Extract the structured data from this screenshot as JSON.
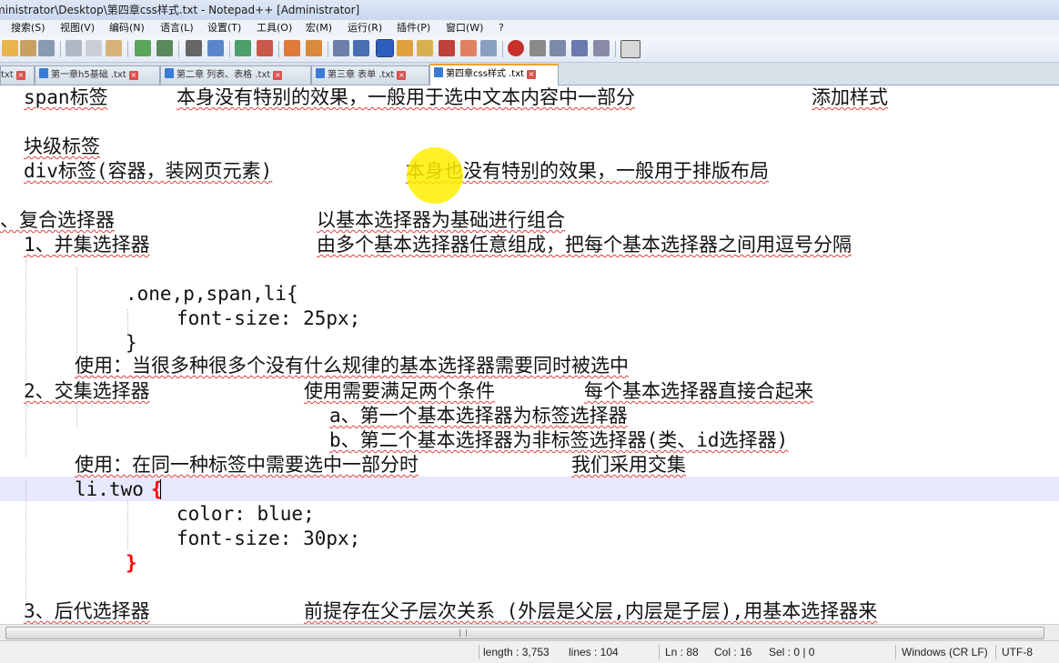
{
  "window": {
    "title": "ministrator\\Desktop\\第四章css样式.txt - Notepad++ [Administrator]"
  },
  "menu": [
    "搜索(S)",
    "视图(V)",
    "编码(N)",
    "语言(L)",
    "设置(T)",
    "工具(O)",
    "宏(M)",
    "运行(R)",
    "插件(P)",
    "窗口(W)",
    "?"
  ],
  "tabs": [
    {
      "label": "txt",
      "active": false
    },
    {
      "label": "第一章h5基础 .txt",
      "active": false
    },
    {
      "label": "第二章 列表、表格 .txt",
      "active": false
    },
    {
      "label": "第三章 表单 .txt",
      "active": false
    },
    {
      "label": "第四章css样式 .txt",
      "active": true
    }
  ],
  "editor": {
    "lines": [
      {
        "a": "span标签",
        "b": "本身没有特别的效果，一般用于选中文本内容中一部分",
        "c": "添加样式"
      },
      {
        "a": "块级标签"
      },
      {
        "a": "div标签(容器，装网页元素)",
        "b": "本身也没有特别的效果，一般用于排版布局"
      },
      {
        "a": "、复合选择器",
        "b": "以基本选择器为基础进行组合"
      },
      {
        "a": "1、并集选择器",
        "b": "由多个基本选择器任意组成，把每个基本选择器之间用逗号分隔"
      },
      {
        "a": ".one,p,span,li{"
      },
      {
        "a": "font-size: 25px;"
      },
      {
        "a": "}"
      },
      {
        "a": "使用：当很多种很多个没有什么规律的基本选择器需要同时被选中"
      },
      {
        "a": "2、交集选择器",
        "b": "使用需要满足两个条件",
        "c": "每个基本选择器直接合起来"
      },
      {
        "a": "a、第一个基本选择器为标签选择器"
      },
      {
        "a": "b、第二个基本选择器为非标签选择器(类、id选择器)"
      },
      {
        "a": "使用：在同一种标签中需要选中一部分时",
        "b": "我们采用交集"
      },
      {
        "a": "li.two",
        "brace": "{"
      },
      {
        "a": "color: blue;"
      },
      {
        "a": "font-size: 30px;"
      },
      {
        "brace": "}"
      },
      {
        "a": "3、后代选择器",
        "b": "前提存在父子层次关系 (外层是父层,内层是子层),用基本选择器来"
      }
    ]
  },
  "status": {
    "length": "length : 3,753",
    "lines": "lines : 104",
    "ln": "Ln : 88",
    "col": "Col : 16",
    "sel": "Sel : 0 | 0",
    "eol": "Windows (CR LF)",
    "encoding": "UTF-8"
  },
  "colors": {
    "brace": "#ff0000",
    "current_line": "#e8e8ff",
    "highlight": "#ffee00",
    "active_tab_accent": "#f0a22a"
  }
}
